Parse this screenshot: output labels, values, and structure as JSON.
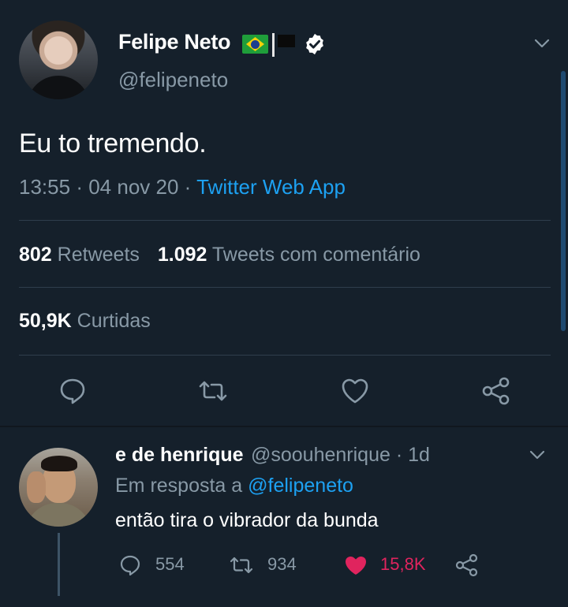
{
  "colors": {
    "background": "#15202b",
    "muted": "#8899a6",
    "accent": "#1da1f2",
    "like_active": "#e0245e",
    "divider": "#2f3d4c"
  },
  "tweet": {
    "author_name": "Felipe Neto",
    "author_handle": "@felipeneto",
    "badges": [
      "brazil-flag-icon",
      "verified-icon"
    ],
    "text": "Eu to tremendo.",
    "time": "13:55",
    "sep1": "·",
    "date": "04 nov 20",
    "sep2": "·",
    "source": "Twitter Web App",
    "retweets_count": "802",
    "retweets_label": "Retweets",
    "quotes_count": "1.092",
    "quotes_label": "Tweets com comentário",
    "likes_count": "50,9K",
    "likes_label": "Curtidas",
    "actions": [
      "reply-icon",
      "retweet-icon",
      "like-icon",
      "share-icon"
    ]
  },
  "reply": {
    "author_name": "e de henrique",
    "author_handle": "@soouhenrique",
    "time": "· 1d",
    "reply_prefix": "Em resposta a",
    "reply_to": "@felipeneto",
    "text": "então tira o vibrador da bunda",
    "reply_count": "554",
    "retweet_count": "934",
    "like_count": "15,8K"
  }
}
